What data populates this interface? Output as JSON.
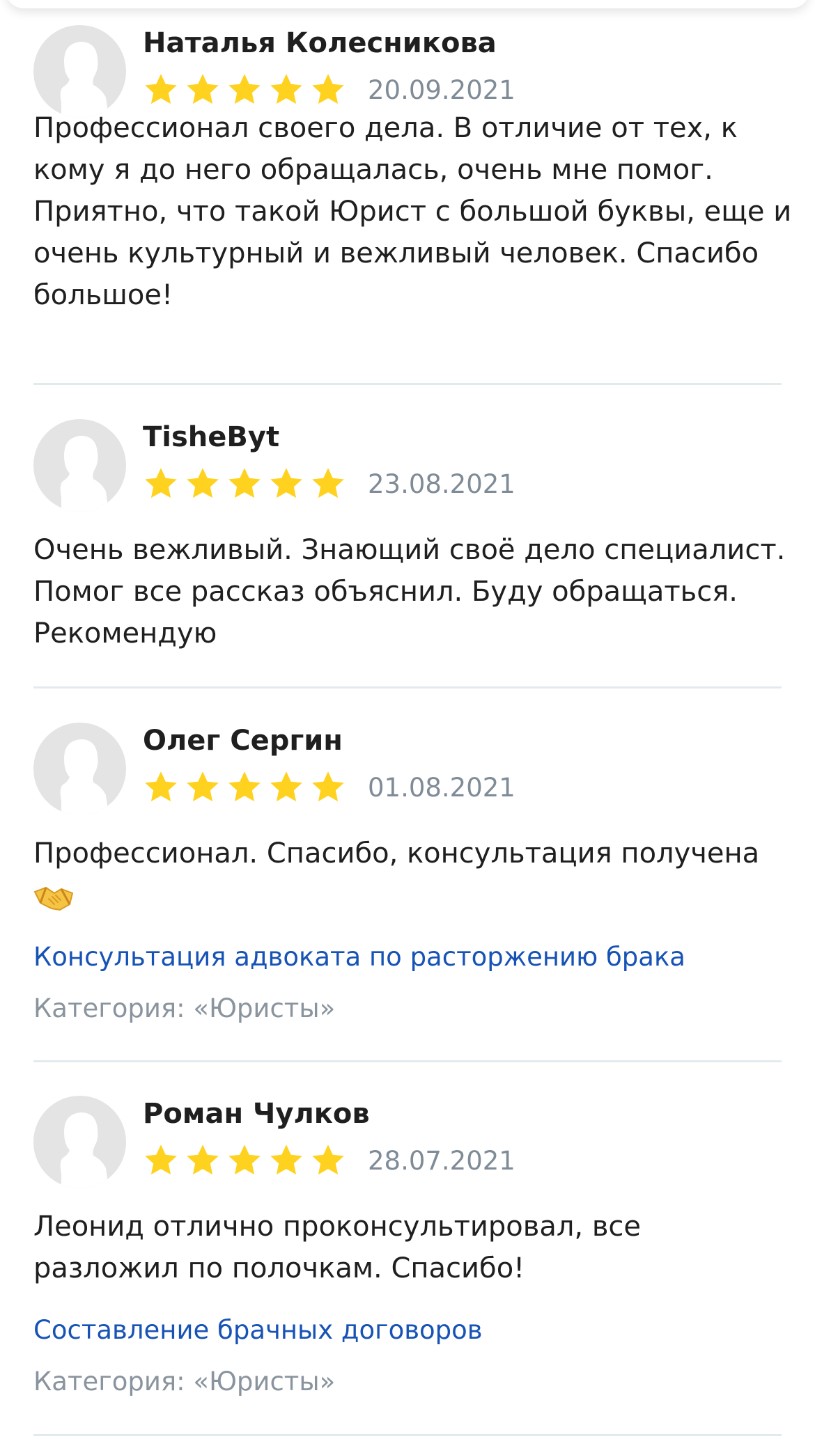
{
  "colors": {
    "star": "#ffd21f",
    "date": "#7f8b97",
    "link": "#1753b5",
    "category": "#8a949e",
    "divider": "#e3eaee",
    "avatar_bg": "#e4e4e4"
  },
  "reviews": [
    {
      "name": "Наталья Колесникова",
      "rating": 5,
      "date": "20.09.2021",
      "text": "Профессионал своего дела. В отличие от тех, к кому я до него обращалась, очень мне помог. Приятно, что такой Юрист с большой буквы, еще и очень культурный и вежливый человек. Спасибо большое!"
    },
    {
      "name": "TisheByt",
      "rating": 5,
      "date": "23.08.2021",
      "text": "Очень вежливый. Знающий своё дело специалист. Помог все рассказ объяснил. Буду обращаться. Рекомендую"
    },
    {
      "name": "Олег Сергин",
      "rating": 5,
      "date": "01.08.2021",
      "text": "Профессионал. Спасибо, консультация получена",
      "emoji": "handshake-emoji",
      "service_link": "Консультация адвоката по расторжению брака",
      "category": "Категория: «Юристы»"
    },
    {
      "name": "Роман Чулков",
      "rating": 5,
      "date": "28.07.2021",
      "text": "Леонид отлично проконсультировал, все разложил по полочкам. Спасибо!",
      "service_link": "Составление брачных договоров",
      "category": "Категория: «Юристы»"
    }
  ]
}
